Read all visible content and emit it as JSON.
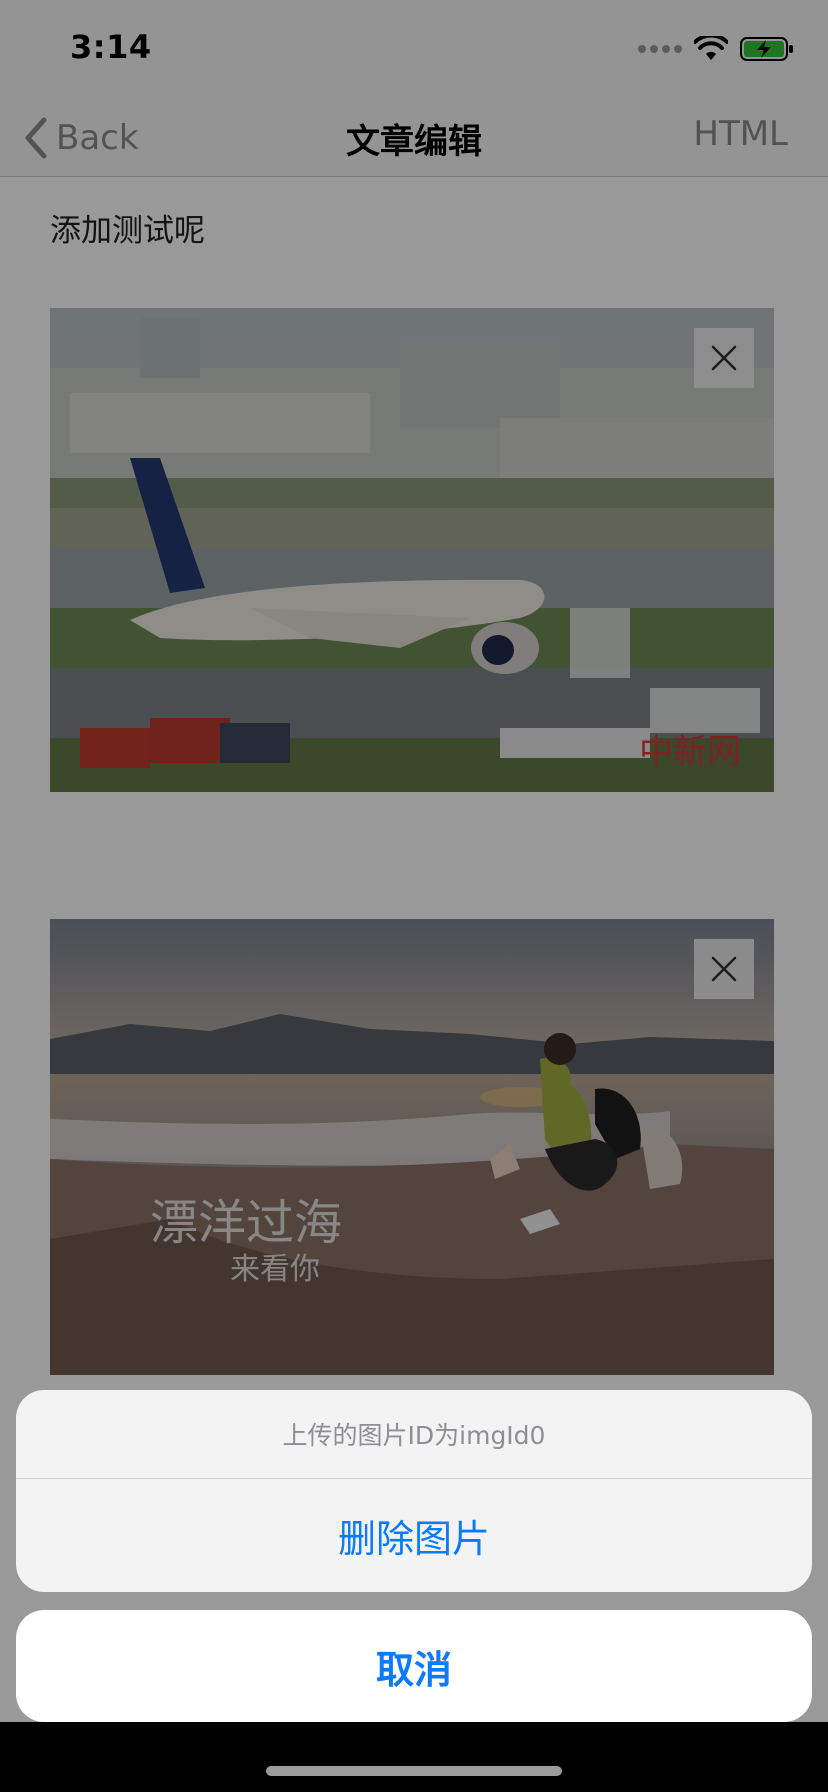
{
  "status_bar": {
    "time": "3:14",
    "signal_icon": "signal-dots-icon",
    "wifi_icon": "wifi-icon",
    "battery_icon": "battery-charging-icon",
    "battery_color": "#36c33c"
  },
  "nav": {
    "back_label": "Back",
    "title": "文章编辑",
    "right_label": "HTML"
  },
  "content": {
    "text": "添加测试呢",
    "images": [
      {
        "name": "airport-photo",
        "close_icon": "close-icon"
      },
      {
        "name": "beach-photo",
        "close_icon": "close-icon"
      }
    ]
  },
  "action_sheet": {
    "message": "上传的图片ID为imgId0",
    "delete_label": "删除图片",
    "cancel_label": "取消",
    "accent_color": "#0a7aff"
  }
}
